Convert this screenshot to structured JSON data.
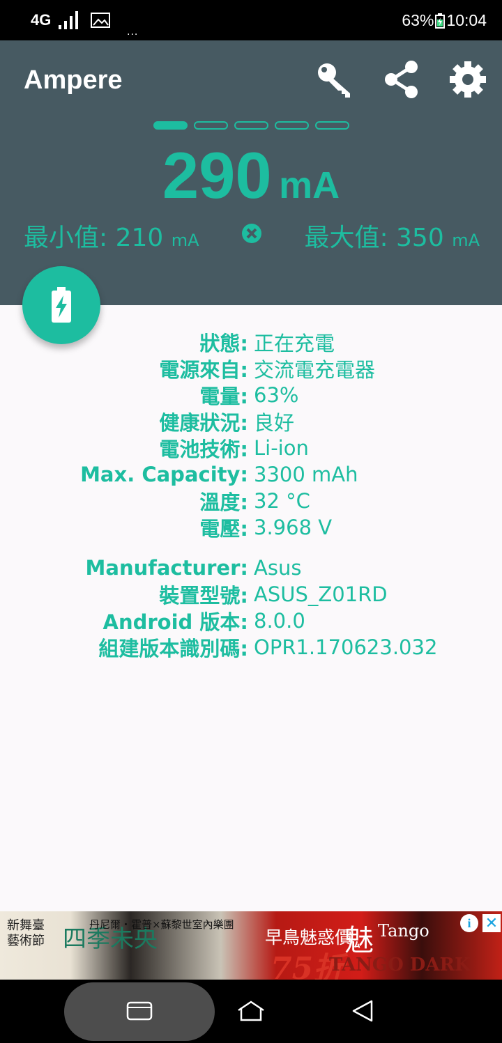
{
  "status_bar": {
    "network": "4G",
    "dots": "...",
    "battery_percent": "63%",
    "time": "10:04"
  },
  "header": {
    "app_title": "Ampere",
    "icons": [
      "key-icon",
      "share-icon",
      "settings-icon"
    ],
    "pager_count": 5,
    "pager_active": 0,
    "current_value": "290",
    "current_unit": "mA",
    "min_label": "最小值:",
    "min_value": "210",
    "min_unit": "mA",
    "max_label": "最大值:",
    "max_value": "350",
    "max_unit": "mA"
  },
  "fab": {
    "icon": "battery-charging-icon"
  },
  "info": {
    "rows": [
      {
        "k": "狀態:",
        "v": "正在充電"
      },
      {
        "k": "電源來自:",
        "v": "交流電充電器"
      },
      {
        "k": "電量:",
        "v": "63%"
      },
      {
        "k": "健康狀況:",
        "v": "良好"
      },
      {
        "k": "電池技術:",
        "v": "Li-ion"
      },
      {
        "k": "Max. Capacity:",
        "v": "3300 mAh"
      },
      {
        "k": "溫度:",
        "v": "32 °C"
      },
      {
        "k": "電壓:",
        "v": "3.968 V"
      }
    ],
    "rows2": [
      {
        "k": "Manufacturer:",
        "v": "Asus"
      },
      {
        "k": "裝置型號:",
        "v": "ASUS_Z01RD"
      },
      {
        "k": "Android 版本:",
        "v": "8.0.0"
      },
      {
        "k": "組建版本識別碼:",
        "v": "OPR1.170623.032"
      }
    ]
  },
  "ad": {
    "festival": "新舞臺\n藝術節",
    "title_chars": "四季未央",
    "performers": "丹尼爾・霍普×蘇黎世室內樂團",
    "early": "早鳥魅惑價",
    "discount": "75折",
    "tango_cn": "魅",
    "tango": "Tango",
    "show": "TANGO DARK",
    "info_label": "i",
    "close_label": "✕"
  },
  "colors": {
    "accent": "#1dbda0",
    "header_bg": "#475a62",
    "body_bg": "#fbf9fb"
  }
}
